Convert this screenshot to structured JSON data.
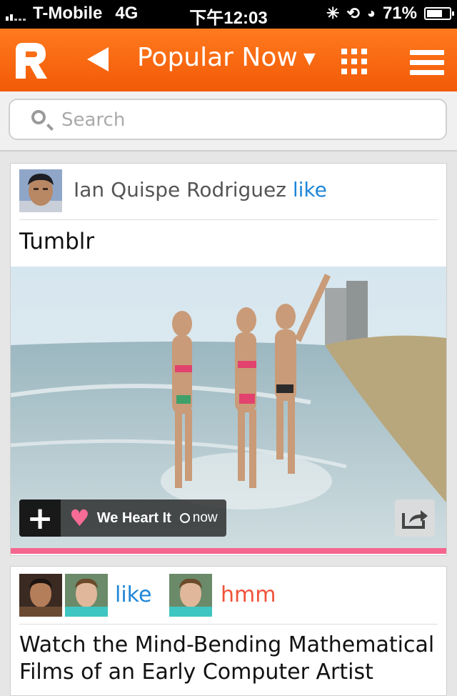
{
  "status": {
    "carrier": "T-Mobile",
    "network": "4G",
    "time": "下午12:03",
    "battery": "71%",
    "battery_level": 0.71
  },
  "nav": {
    "title": "Popular Now",
    "title_chevron": "chevron-down-icon",
    "back_icon": "back-arrow-icon",
    "grid_icon": "grid-icon",
    "menu_icon": "hamburger-menu-icon",
    "brand_color": "#f56a0f"
  },
  "search": {
    "placeholder": "Search"
  },
  "feed": [
    {
      "user": "Ian Quispe Rodriguez",
      "reaction": "like",
      "title": "Tumblr",
      "source": "We Heart It",
      "time": "now"
    },
    {
      "reactions": [
        {
          "label": "like",
          "color": "#1f86d8"
        },
        {
          "label": "hmm",
          "color": "#f0523a"
        }
      ],
      "title": "Watch the Mind-Bending Mathematical Films of an Early Computer Artist"
    }
  ]
}
